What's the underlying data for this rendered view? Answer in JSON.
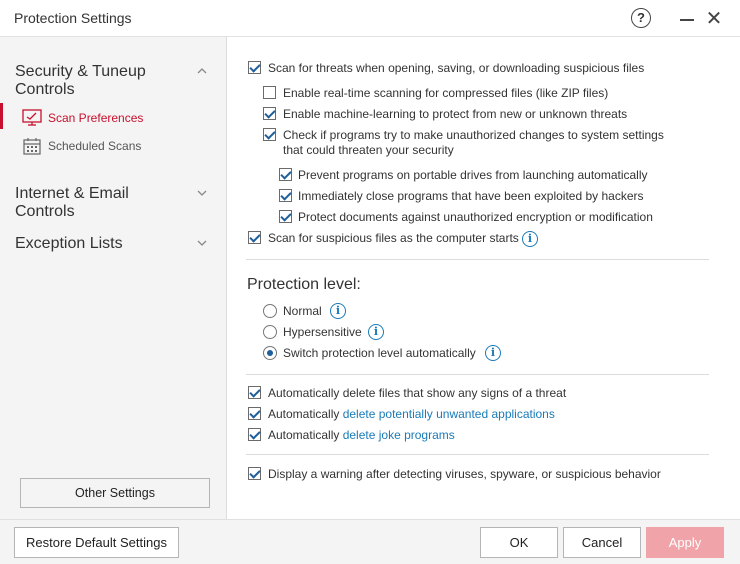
{
  "window": {
    "title": "Protection Settings",
    "help_icon": "?",
    "close_icon": "✕"
  },
  "sidebar": {
    "groups": [
      {
        "label": "Security & Tuneup Controls",
        "expanded": true
      },
      {
        "label": "Internet & Email Controls",
        "expanded": false
      },
      {
        "label": "Exception Lists",
        "expanded": false
      }
    ],
    "sub_items": [
      {
        "label": "Scan Preferences",
        "icon": "monitor-icon",
        "active": true
      },
      {
        "label": "Scheduled Scans",
        "icon": "calendar-icon",
        "active": false
      }
    ],
    "other_settings_label": "Other Settings"
  },
  "content": {
    "options": [
      {
        "label": "Scan for threats when opening, saving, or downloading suspicious files",
        "checked": true
      },
      {
        "label": "Enable real-time scanning for compressed files (like ZIP files)",
        "checked": false
      },
      {
        "label": "Enable machine-learning to protect from new or unknown threats",
        "checked": true
      },
      {
        "label_line1": "Check if programs try to make unauthorized changes to system settings",
        "label_line2": "that could threaten your security",
        "checked": true
      },
      {
        "label": "Prevent programs on portable drives from launching automatically",
        "checked": true
      },
      {
        "label": "Immediately close programs that have been exploited by hackers",
        "checked": true
      },
      {
        "label": "Protect documents against unauthorized encryption or modification",
        "checked": true
      },
      {
        "label": "Scan for suspicious files as the computer starts",
        "checked": true
      }
    ],
    "protection_level": {
      "title": "Protection level:",
      "options": [
        {
          "label": "Normal",
          "selected": false
        },
        {
          "label": "Hypersensitive",
          "selected": false
        },
        {
          "label": "Switch protection level automatically",
          "selected": true
        }
      ]
    },
    "delete_options": [
      {
        "prefix": "Automatically delete files that show any signs of a threat",
        "link": "",
        "checked": true
      },
      {
        "prefix": "Automatically ",
        "link": "delete potentially unwanted applications",
        "checked": true
      },
      {
        "prefix": "Automatically ",
        "link": "delete joke programs",
        "checked": true
      }
    ],
    "warning_option": {
      "label": "Display a warning after detecting viruses, spyware, or suspicious behavior",
      "checked": true
    }
  },
  "footer": {
    "restore_label": "Restore Default Settings",
    "ok_label": "OK",
    "cancel_label": "Cancel",
    "apply_label": "Apply"
  },
  "colors": {
    "accent_red": "#c8102e",
    "link_blue": "#1a7bb8",
    "apply_disabled": "#f0a4a9"
  }
}
